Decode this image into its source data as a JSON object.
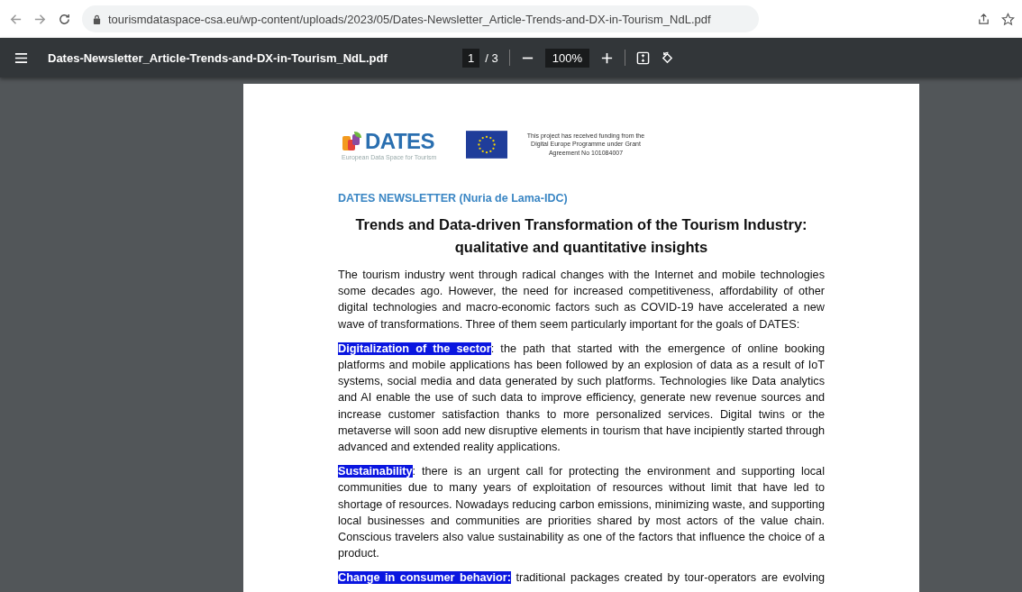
{
  "browser": {
    "url": "tourismdataspace-csa.eu/wp-content/uploads/2023/05/Dates-Newsletter_Article-Trends-and-DX-in-Tourism_NdL.pdf"
  },
  "viewer": {
    "filename": "Dates-Newsletter_Article-Trends-and-DX-in-Tourism_NdL.pdf",
    "page": "1",
    "page_count": "/ 3",
    "zoom": "100%"
  },
  "document": {
    "logo": {
      "name": "DATES",
      "tagline": "European Data Space for Tourism"
    },
    "funding_note": "This project has received funding from the Digital Europe Programme under Grant Agreement No 101084007",
    "byline": "DATES NEWSLETTER (Nuria de Lama-IDC)",
    "title": "Trends and Data-driven Transformation of the Tourism Industry: qualitative and quantitative insights",
    "paragraphs": [
      {
        "text": "The tourism industry went through radical changes with the Internet and mobile technologies some decades ago. However, the need for increased competitiveness, affordability of other digital technologies and macro-economic factors such as COVID-19 have accelerated a new wave of transformations. Three of them seem particularly important for the goals of DATES:"
      },
      {
        "text": "**Digitalization of the sector**: the path that started with the emergence of online booking platforms and mobile applications has been followed by an explosion of data as a result of IoT systems, social media and data generated by such platforms. Technologies like Data analytics and AI enable the use of such data to improve efficiency, generate new revenue sources and increase customer satisfaction thanks to more personalized services. Digital twins or the metaverse will soon add new disruptive elements in tourism that have incipiently started through advanced and extended reality applications."
      },
      {
        "text": "**Sustainability**: there is an urgent call for protecting the environment and supporting local communities due to many years of exploitation of resources without limit that have led to shortage of resources. Nowadays reducing carbon emissions, minimizing waste, and supporting local businesses and communities are priorities shared by most actors of the value chain. Conscious travelers also value sustainability as one of the factors that influence the choice of a product."
      },
      {
        "text": "**Change in consumer behavior:** traditional packages created by tour-operators are evolving"
      }
    ]
  }
}
